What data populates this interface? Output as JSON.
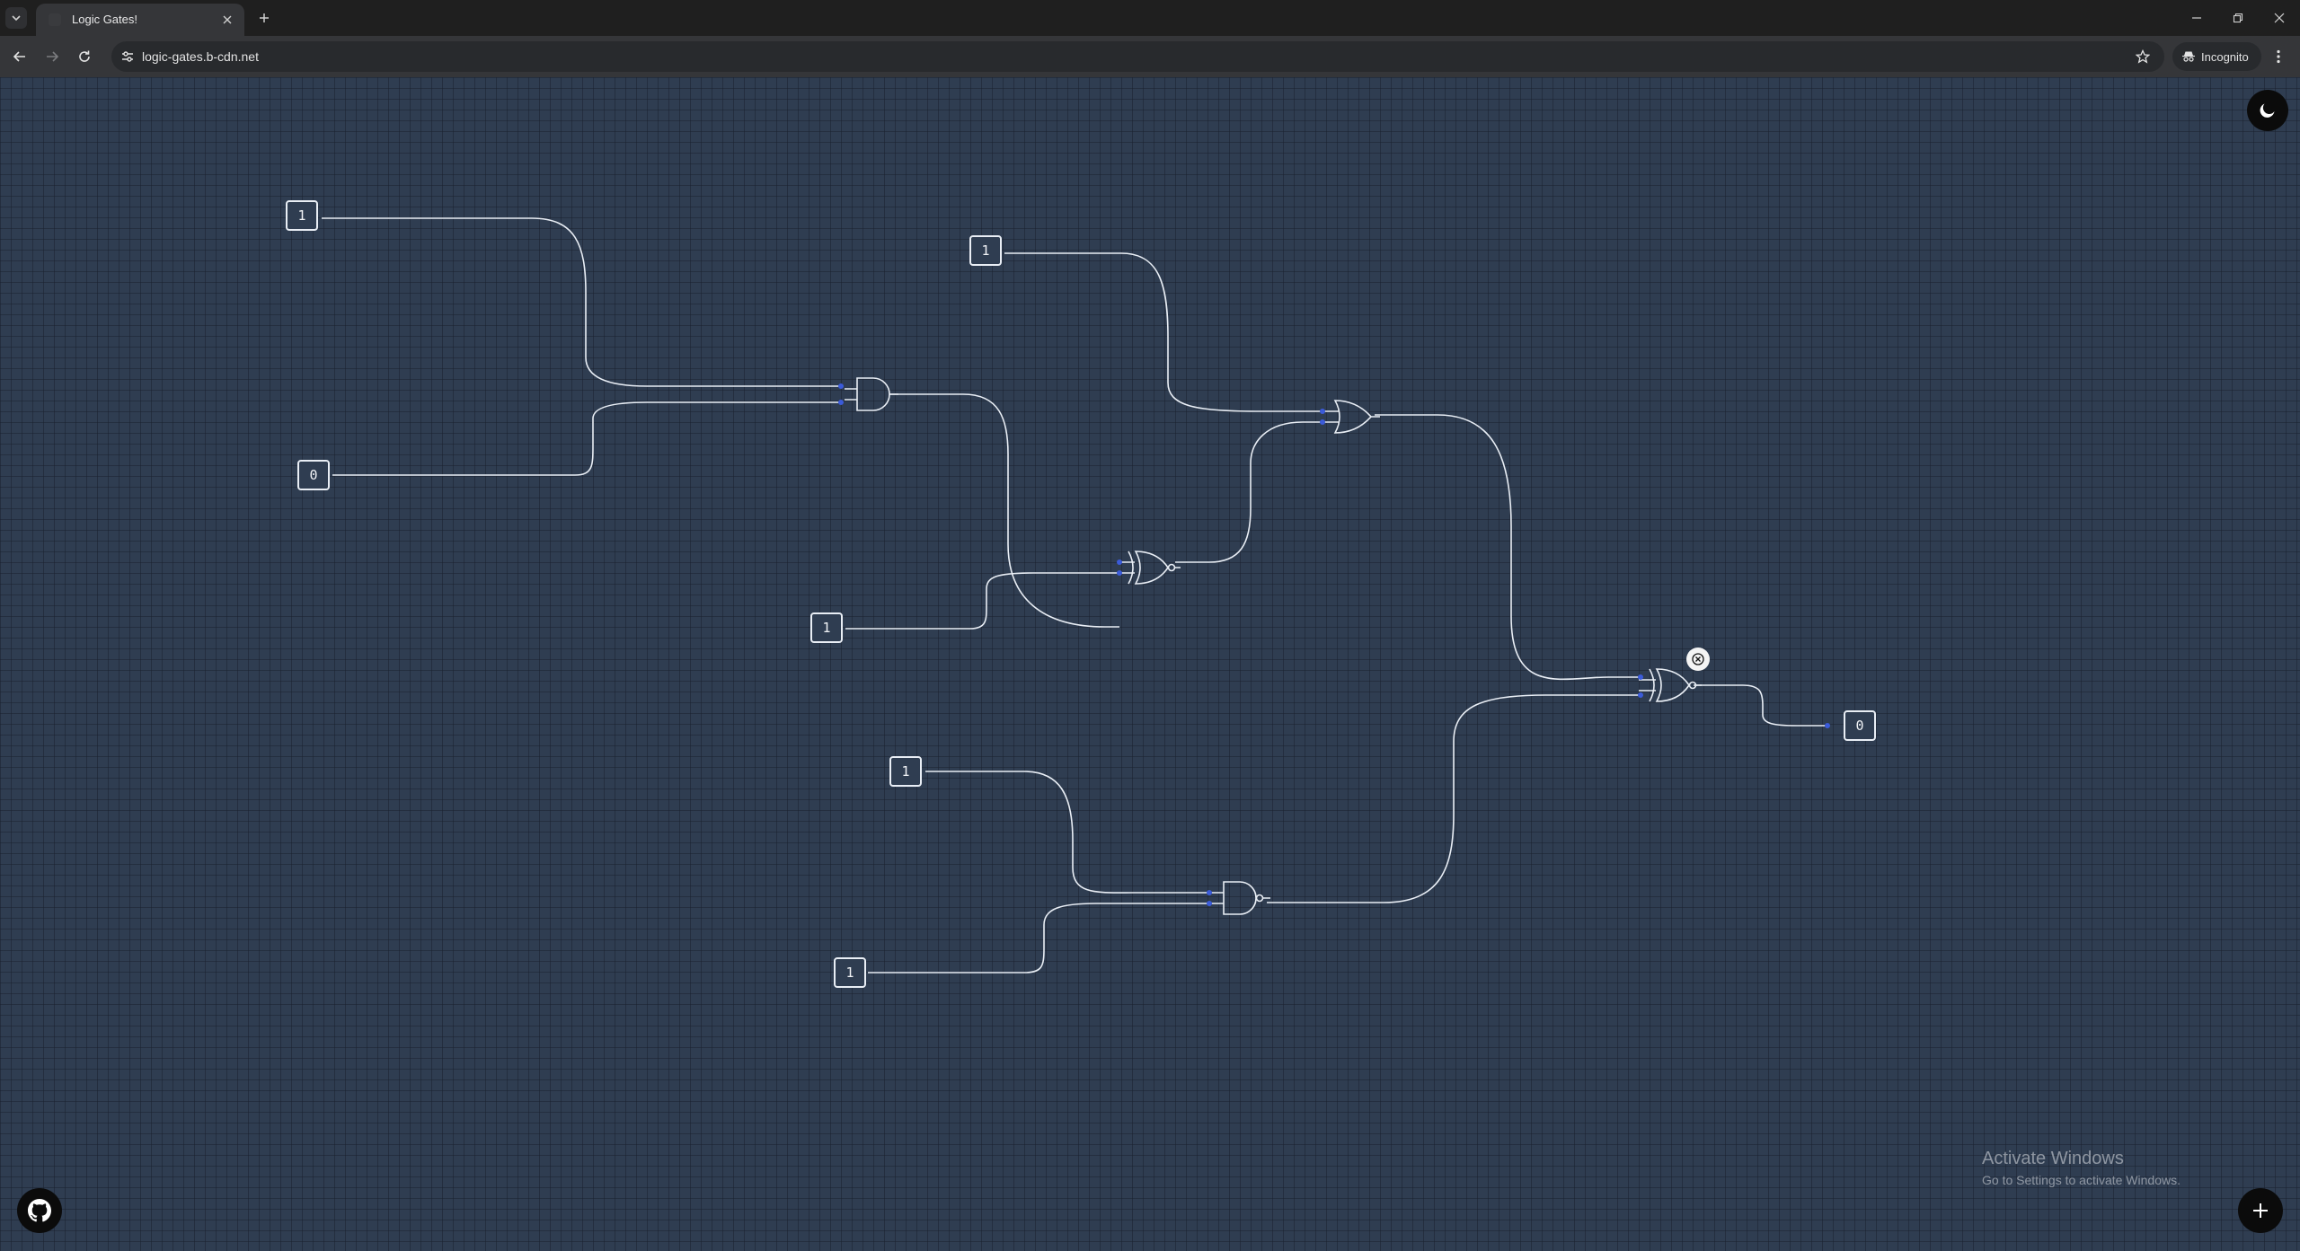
{
  "browser": {
    "tab_title": "Logic Gates!",
    "url": "logic-gates.b-cdn.net",
    "incognito_label": "Incognito"
  },
  "circuit": {
    "inputs": [
      {
        "id": "in1",
        "value": "1"
      },
      {
        "id": "in2",
        "value": "0"
      },
      {
        "id": "in3",
        "value": "1"
      },
      {
        "id": "in4",
        "value": "1"
      },
      {
        "id": "in5",
        "value": "1"
      },
      {
        "id": "in6",
        "value": "1"
      }
    ],
    "output": {
      "id": "out1",
      "value": "0"
    },
    "gates": [
      {
        "id": "g1",
        "type": "AND"
      },
      {
        "id": "g2",
        "type": "XNOR"
      },
      {
        "id": "g3",
        "type": "OR"
      },
      {
        "id": "g4",
        "type": "NAND"
      },
      {
        "id": "g5",
        "type": "XNOR"
      }
    ],
    "colors": {
      "wire": "#e9eef5",
      "pin": "#3b5bd9",
      "background": "#2f3d51"
    }
  },
  "controls": {
    "theme_icon": "moon-icon",
    "github_icon": "github-icon",
    "add_icon": "plus-icon",
    "delete_icon": "close-icon"
  },
  "os_watermark": {
    "title": "Activate Windows",
    "subtitle": "Go to Settings to activate Windows."
  }
}
